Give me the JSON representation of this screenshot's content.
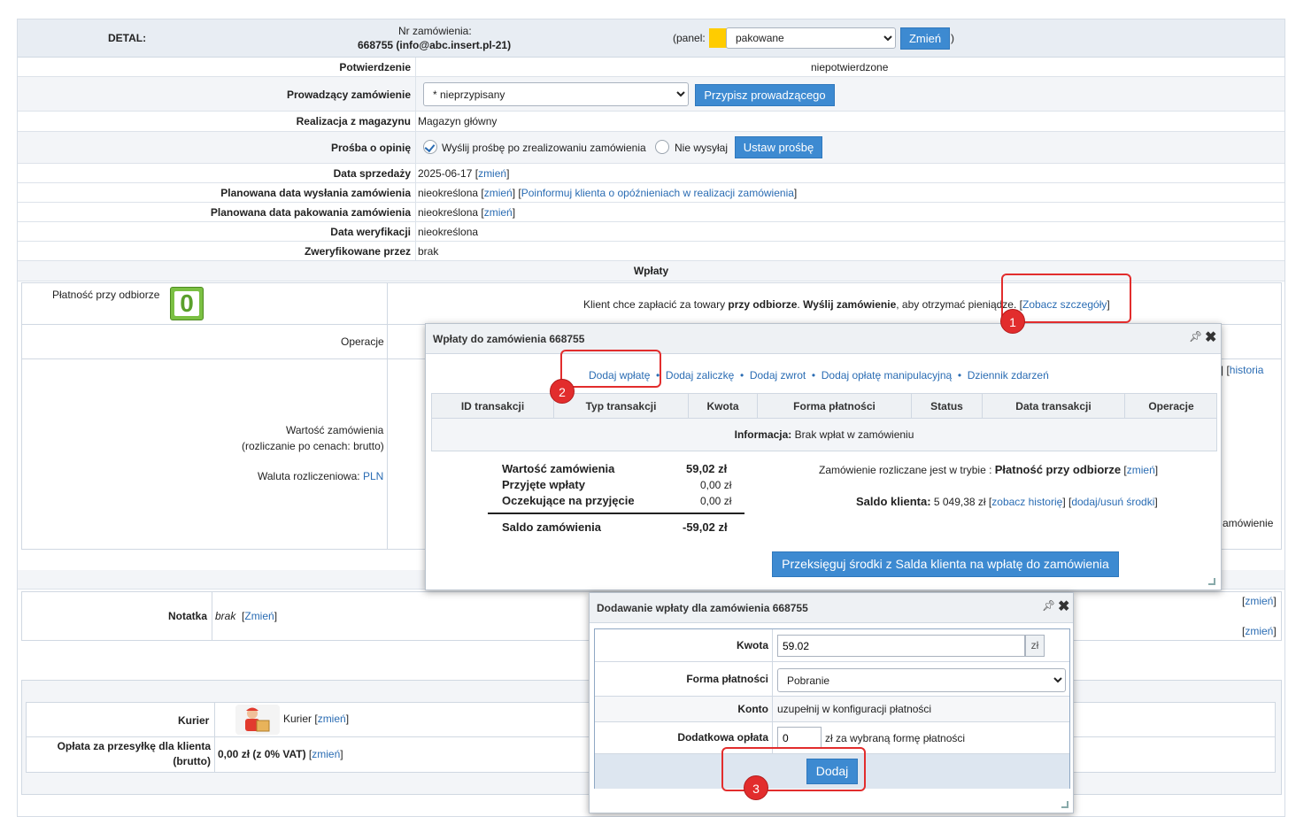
{
  "header": {
    "detal": "DETAL:",
    "order_label": "Nr zamówienia:",
    "order_id": "668755 (info@abc.insert.pl-21)",
    "panel_open": "(panel:",
    "panel_close": ")",
    "status_value": "pakowane",
    "change_btn": "Zmień",
    "status_color": "#ffcc00"
  },
  "rows": {
    "potwierdzenie": {
      "label": "Potwierdzenie",
      "value": "niepotwierdzone"
    },
    "prowadzacy": {
      "label": "Prowadzący zamówienie",
      "select": "* nieprzypisany",
      "button": "Przypisz prowadzącego"
    },
    "realizacja": {
      "label": "Realizacja z magazynu",
      "value": "Magazyn główny"
    },
    "prosba": {
      "label": "Prośba o opinię",
      "option1": "Wyślij prośbę po zrealizowaniu zamówienia",
      "option2": "Nie wysyłaj",
      "button": "Ustaw prośbę"
    },
    "data_sprzedazy": {
      "label": "Data sprzedaży",
      "value": "2025-06-17",
      "link_open": "[",
      "link": "zmień",
      "link_close": "]"
    },
    "planowana_wysylka": {
      "label": "Planowana data wysłania zamówienia",
      "value": "nieokreślona",
      "link": "zmień",
      "link2": "Poinformuj klienta o opóźnieniach w realizacji zamówienia"
    },
    "planowana_pakowanie": {
      "label": "Planowana data pakowania zamówienia",
      "value": "nieokreślona",
      "link": "zmień"
    },
    "data_weryfikacji": {
      "label": "Data weryfikacji",
      "value": "nieokreślona"
    },
    "zweryfikowane": {
      "label": "Zweryfikowane przez",
      "value": "brak"
    },
    "wplaty_header": "Wpłaty"
  },
  "payment": {
    "label": "Płatność przy odbiorze",
    "badge": "0",
    "info_pre": "Klient chce zapłacić za towary ",
    "info_b1": "przy odbiorze",
    "info_mid": ". ",
    "info_b2": "Wyślij zamówienie",
    "info_post": ", aby otrzymać pieniądze. [",
    "info_link": "Zobacz szczegóły",
    "info_close": "]",
    "operacje": "Operacje",
    "historia": "historia",
    "wartosc": "Wartość zamówienia",
    "rozliczanie": "(rozliczanie po cenach: brutto)",
    "waluta": "Waluta rozliczeniowa:",
    "waluta_val": "PLN",
    "zamowienie_trunc": "amówienie"
  },
  "notatka": {
    "label": "Notatka",
    "value": "brak",
    "link": "Zmień",
    "right1": "zmień",
    "right2": "zmień"
  },
  "kurier": {
    "label": "Kurier",
    "value": "Kurier",
    "link": "zmień",
    "oplata_label1": "Opłata za przesyłkę dla klienta",
    "oplata_label2": "(brutto)",
    "oplata_value": "0,00 zł (z 0% VAT)",
    "oplata_link": "zmień"
  },
  "dialog1": {
    "title": "Wpłaty do zamówienia 668755",
    "actions": [
      "Dodaj wpłatę",
      "Dodaj zaliczkę",
      "Dodaj zwrot",
      "Dodaj opłatę manipulacyjną",
      "Dziennik zdarzeń"
    ],
    "columns": [
      "ID transakcji",
      "Typ transakcji",
      "Kwota",
      "Forma płatności",
      "Status",
      "Data transakcji",
      "Operacje"
    ],
    "info_label": "Informacja:",
    "info_text": "Brak wpłat w zamówieniu",
    "summary": [
      {
        "label": "Wartość zamówienia",
        "value": "59,02 zł"
      },
      {
        "label": "Przyjęte wpłaty",
        "value": "0,00 zł"
      },
      {
        "label": "Oczekujące na przyjęcie",
        "value": "0,00 zł"
      }
    ],
    "saldo_label": "Saldo zamówienia",
    "saldo_value": "-59,02 zł",
    "mode_text": "Zamówienie rozliczane jest w trybie :",
    "mode_value": "Płatność przy odbiorze",
    "mode_link": "zmień",
    "saldo_klienta_label": "Saldo klienta:",
    "saldo_klienta_value": "5 049,38 zł",
    "historia_link": "zobacz historię",
    "srodki_link": "dodaj/usuń środki",
    "transfer_btn": "Przeksięguj środki z Salda klienta na wpłatę do zamówienia"
  },
  "dialog2": {
    "title": "Dodawanie wpłaty dla zamówienia 668755",
    "kwota_label": "Kwota",
    "kwota_value": "59.02",
    "currency": "zł",
    "forma_label": "Forma płatności",
    "forma_value": "Pobranie",
    "konto_label": "Konto",
    "konto_value": "uzupełnij w konfiguracji płatności",
    "dodatkowa_label": "Dodatkowa opłata",
    "dodatkowa_value": "0",
    "dodatkowa_suffix": "zł za wybraną formę płatności",
    "submit": "Dodaj"
  },
  "markers": [
    "1",
    "2",
    "3"
  ]
}
